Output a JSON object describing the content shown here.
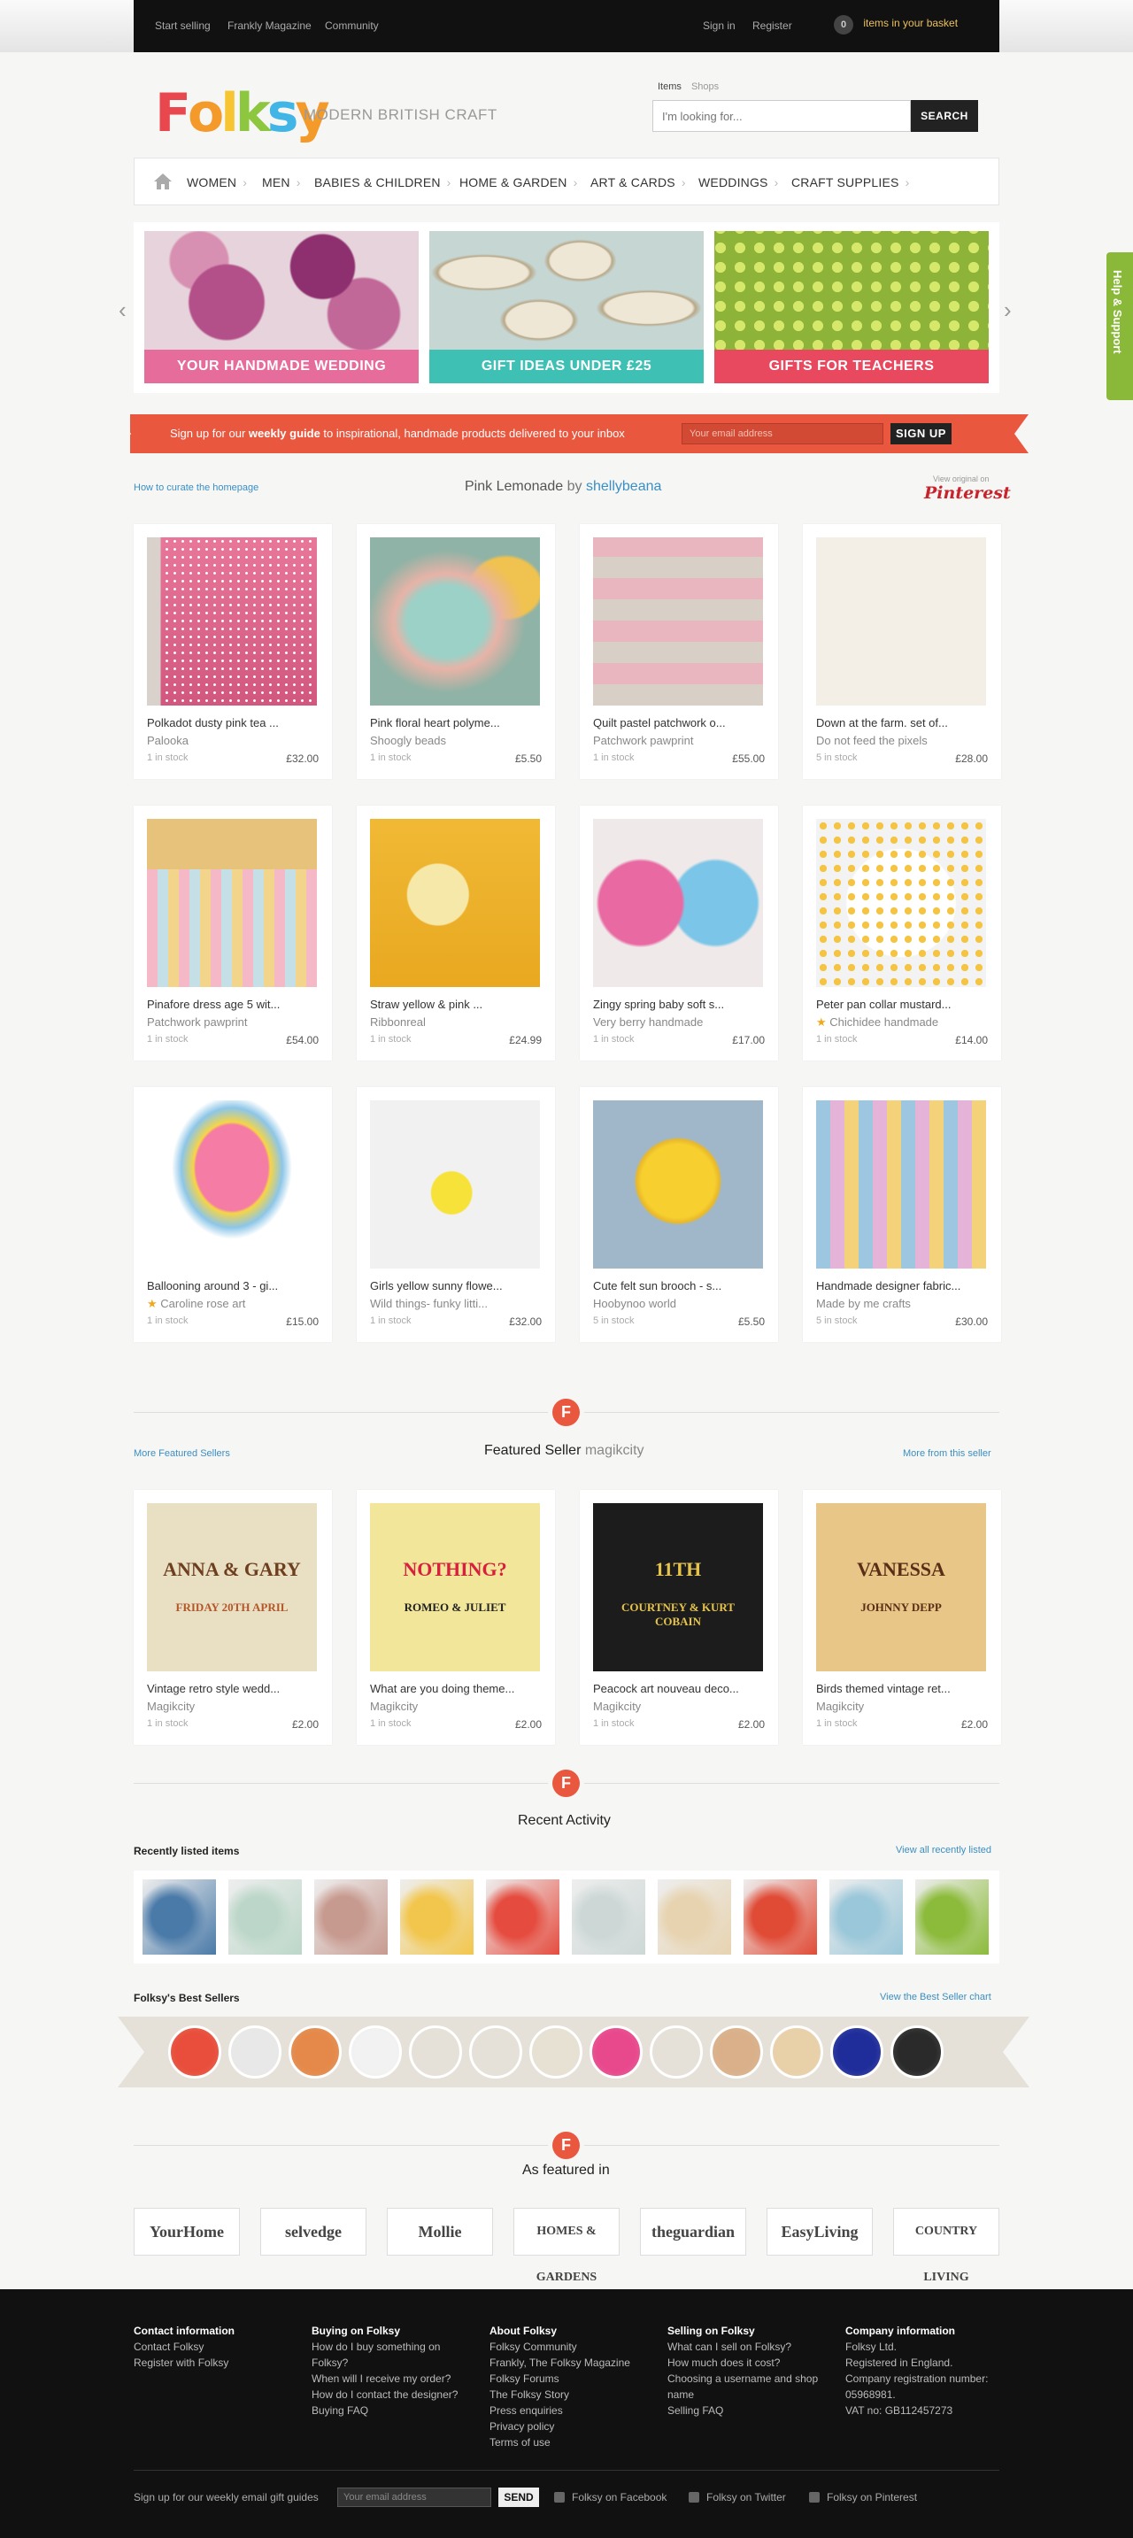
{
  "topbar": {
    "start_selling": "Start selling",
    "magazine": "Frankly Magazine",
    "community": "Community",
    "sign_in": "Sign in",
    "register": "Register",
    "basket_count": "0",
    "basket_label": "items in your basket"
  },
  "header": {
    "logo": "Folksy",
    "tagline": "MODERN BRITISH CRAFT",
    "tab_items": "Items",
    "tab_shops": "Shops",
    "search_placeholder": "I'm looking for...",
    "search_button": "SEARCH"
  },
  "nav": {
    "items": [
      "WOMEN",
      "MEN",
      "BABIES & CHILDREN",
      "HOME & GARDEN",
      "ART & CARDS",
      "WEDDINGS",
      "CRAFT SUPPLIES"
    ]
  },
  "banners": [
    {
      "caption": "YOUR HANDMADE WEDDING",
      "color": "#e56c9b"
    },
    {
      "caption": "GIFT IDEAS UNDER £25",
      "color": "#3ec0b4"
    },
    {
      "caption": "GIFTS FOR TEACHERS",
      "color": "#e8495f"
    }
  ],
  "signup": {
    "text_pre": "Sign up for our ",
    "text_bold": "weekly guide",
    "text_post": " to inspirational, handmade products delivered to your inbox",
    "placeholder": "Your email address",
    "button": "SIGN UP"
  },
  "pinterest_section": {
    "curate_link": "How to curate the homepage",
    "title": "Pink Lemonade",
    "by": "by",
    "curator": "shellybeana",
    "view_original": "View original on",
    "brand": "Pinterest"
  },
  "products": [
    {
      "title": "Polkadot dusty pink tea ...",
      "seller": "Palooka",
      "stock": "1 in stock",
      "price": "£32.00",
      "star": false
    },
    {
      "title": "Pink floral heart polyme...",
      "seller": "Shoogly beads",
      "stock": "1 in stock",
      "price": "£5.50",
      "star": false
    },
    {
      "title": "Quilt pastel patchwork o...",
      "seller": "Patchwork pawprint",
      "stock": "1 in stock",
      "price": "£55.00",
      "star": false
    },
    {
      "title": "Down at the farm. set of...",
      "seller": "Do not feed the pixels",
      "stock": "5 in stock",
      "price": "£28.00",
      "star": false
    },
    {
      "title": "Pinafore dress age 5 wit...",
      "seller": "Patchwork pawprint",
      "stock": "1 in stock",
      "price": "£54.00",
      "star": false
    },
    {
      "title": "Straw yellow & pink ...",
      "seller": "Ribbonreal",
      "stock": "1 in stock",
      "price": "£24.99",
      "star": false
    },
    {
      "title": "Zingy spring baby soft s...",
      "seller": "Very berry handmade",
      "stock": "1 in stock",
      "price": "£17.00",
      "star": false
    },
    {
      "title": "Peter pan collar mustard...",
      "seller": "Chichidee handmade",
      "stock": "1 in stock",
      "price": "£14.00",
      "star": true
    },
    {
      "title": "Ballooning around 3 - gi...",
      "seller": "Caroline rose art",
      "stock": "1 in stock",
      "price": "£15.00",
      "star": true
    },
    {
      "title": "Girls yellow sunny flowe...",
      "seller": "Wild things- funky litti...",
      "stock": "1 in stock",
      "price": "£32.00",
      "star": false
    },
    {
      "title": "Cute felt sun brooch - s...",
      "seller": "Hoobynoo world",
      "stock": "5 in stock",
      "price": "£5.50",
      "star": false
    },
    {
      "title": "Handmade designer fabric...",
      "seller": "Made by me crafts",
      "stock": "5 in stock",
      "price": "£30.00",
      "star": false
    }
  ],
  "featured": {
    "more_sellers": "More Featured Sellers",
    "title": "Featured Seller",
    "seller": "magikcity",
    "more_from": "More from this seller"
  },
  "featured_products": [
    {
      "title": "Vintage retro style wedd...",
      "seller": "Magikcity",
      "stock": "1 in stock",
      "price": "£2.00",
      "text1": "ANNA & GARY",
      "text2": "FRIDAY 20TH APRIL"
    },
    {
      "title": "What are you doing theme...",
      "seller": "Magikcity",
      "stock": "1 in stock",
      "price": "£2.00",
      "text1": "NOTHING?",
      "text2": "ROMEO & JULIET"
    },
    {
      "title": "Peacock art nouveau deco...",
      "seller": "Magikcity",
      "stock": "1 in stock",
      "price": "£2.00",
      "text1": "11TH",
      "text2": "COURTNEY & KURT COBAIN"
    },
    {
      "title": "Birds themed vintage ret...",
      "seller": "Magikcity",
      "stock": "1 in stock",
      "price": "£2.00",
      "text1": "VANESSA",
      "text2": "JOHNNY DEPP"
    }
  ],
  "recent": {
    "title": "Recent Activity",
    "listed": "Recently listed items",
    "view_all": "View all recently listed",
    "best": "Folksy's Best Sellers",
    "view_chart": "View the Best Seller chart"
  },
  "press": {
    "title": "As featured in",
    "logos": [
      "YourHome",
      "selvedge",
      "Mollie",
      "HOMES & GARDENS",
      "theguardian",
      "EasyLiving",
      "COUNTRY LIVING"
    ]
  },
  "footer": {
    "cols": [
      {
        "heading": "Contact information",
        "links": [
          "Contact Folksy",
          "Register with Folksy"
        ]
      },
      {
        "heading": "Buying on Folksy",
        "links": [
          "How do I buy something on Folksy?",
          "When will I receive my order?",
          "How do I contact the designer?",
          "Buying FAQ"
        ]
      },
      {
        "heading": "About Folksy",
        "links": [
          "Folksy Community",
          "Frankly, The Folksy Magazine",
          "Folksy Forums",
          "The Folksy Story",
          "Press enquiries",
          "Privacy policy",
          "Terms of use"
        ]
      },
      {
        "heading": "Selling on Folksy",
        "links": [
          "What can I sell on Folksy?",
          "How much does it cost?",
          "Choosing a username and shop name",
          "Selling FAQ"
        ]
      },
      {
        "heading": "Company information",
        "links": [
          "Folksy Ltd.",
          "Registered in England.",
          "Company registration number: 05968981.",
          "VAT no: GB112457273"
        ]
      }
    ],
    "signup": "Sign up for our weekly email gift guides",
    "placeholder": "Your email address",
    "send": "SEND",
    "facebook": "Folksy on Facebook",
    "twitter": "Folksy on Twitter",
    "pinterest": "Folksy on Pinterest"
  },
  "help_tab": "Help & Support"
}
